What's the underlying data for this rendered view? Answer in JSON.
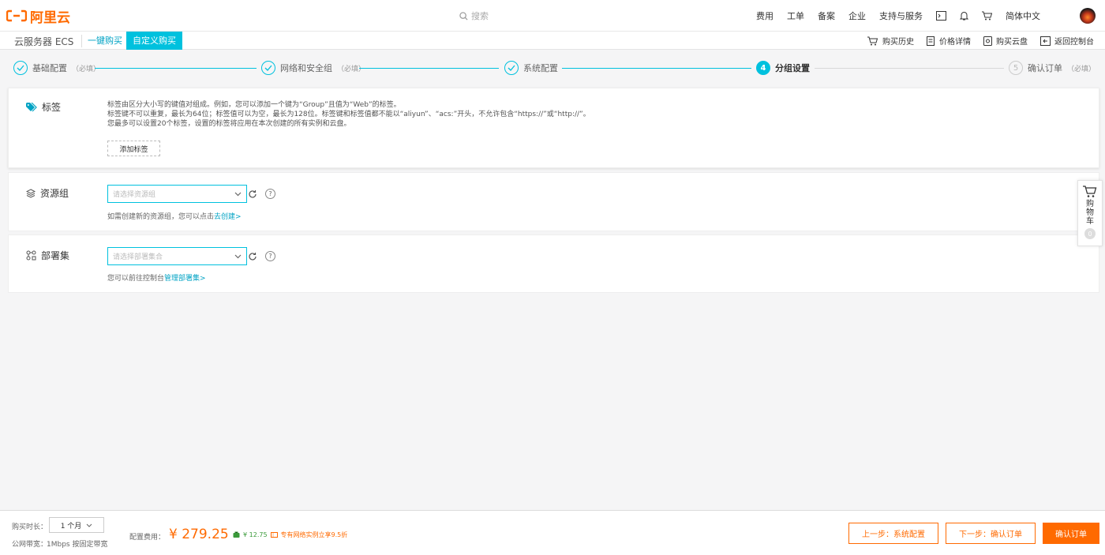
{
  "header": {
    "logo_text": "阿里云",
    "search_placeholder": "搜索",
    "nav": [
      "费用",
      "工单",
      "备案",
      "企业",
      "支持与服务"
    ],
    "language": "简体中文"
  },
  "subbar": {
    "product": "云服务器 ECS",
    "mode_tabs": [
      {
        "label": "一键购买",
        "active": false
      },
      {
        "label": "自定义购买",
        "active": true
      }
    ],
    "links": [
      "购买历史",
      "价格详情",
      "购买云盘",
      "返回控制台"
    ]
  },
  "steps": [
    {
      "label": "基础配置",
      "required": "（必填）",
      "status": "done"
    },
    {
      "label": "网络和安全组",
      "required": "（必填）",
      "status": "done"
    },
    {
      "label": "系统配置",
      "required": "",
      "status": "done"
    },
    {
      "label": "分组设置",
      "required": "",
      "status": "current",
      "number": "4"
    },
    {
      "label": "确认订单",
      "required": "（必填）",
      "status": "todo",
      "number": "5"
    }
  ],
  "tags": {
    "title": "标签",
    "desc_lines": [
      "标签由区分大小写的键值对组成。例如，您可以添加一个键为“Group”且值为“Web”的标签。",
      "标签键不可以重复，最长为64位；标签值可以为空，最长为128位。标签键和标签值都不能以“aliyun”、“acs:”开头，不允许包含“https://”或“http://”。",
      "您最多可以设置20个标签，设置的标签将应用在本次创建的所有实例和云盘。"
    ],
    "add_button": "添加标签"
  },
  "resource_group": {
    "title": "资源组",
    "placeholder": "请选择资源组",
    "hint": "如需创建新的资源组，您可以点击",
    "hint_link": "去创建>"
  },
  "deployment_set": {
    "title": "部署集",
    "placeholder": "请选择部署集合",
    "hint": "您可以前往控制台",
    "hint_link": "管理部署集>"
  },
  "cart": {
    "label_chars": [
      "购",
      "物",
      "车"
    ],
    "count": "0"
  },
  "bottom": {
    "duration_label": "购买时长：",
    "duration_value": "1 个月",
    "bandwidth_label": "公网带宽：",
    "bandwidth_value": "1Mbps 按固定带宽",
    "fee_label": "配置费用：",
    "price": "¥ 279.25",
    "saving": "¥ 12.75",
    "promo": "专有网络实例立享9.5折",
    "prev_button": "上一步：系统配置",
    "next_button": "下一步：确认订单",
    "confirm_button": "确认订单"
  },
  "colors": {
    "brand": "#ff6a00",
    "accent": "#00c1de"
  }
}
